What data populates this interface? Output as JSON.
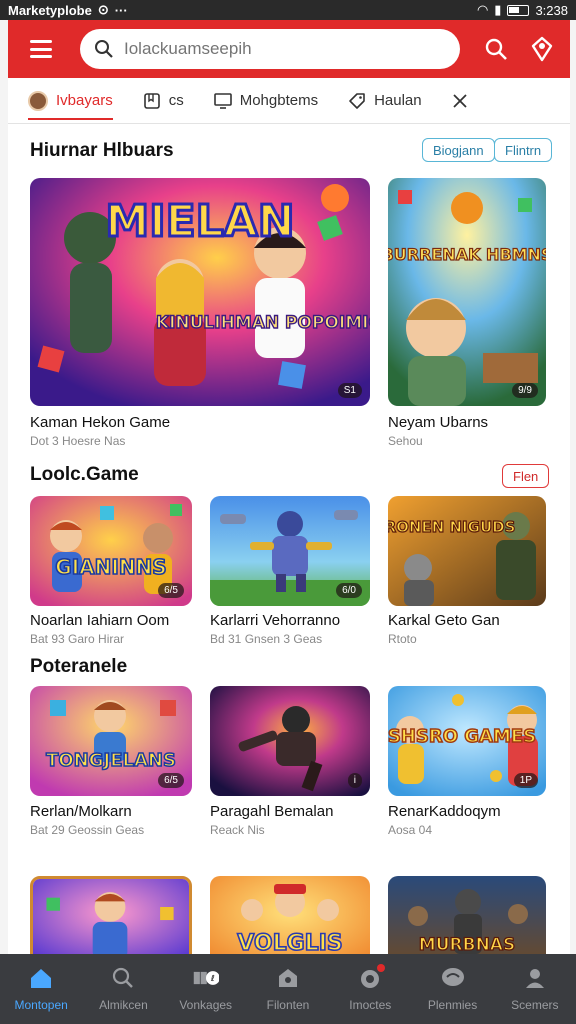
{
  "status_bar": {
    "app_name": "Marketyplobe",
    "time": "3:238"
  },
  "app_bar": {
    "search_placeholder": "Iolackuamseepih",
    "colors": {
      "brand": "#e02a2a"
    }
  },
  "filter_tabs": [
    {
      "label": "Ivbayars",
      "icon": "avatar-icon",
      "active": true
    },
    {
      "label": "cs",
      "icon": "bookmark-icon",
      "active": false
    },
    {
      "label": "Mohgbtems",
      "icon": "monitor-icon",
      "active": false
    },
    {
      "label": "Haulan",
      "icon": "tag-icon",
      "active": false
    }
  ],
  "sections": [
    {
      "title": "Hiurnar Hlbuars",
      "pills": [
        "Biogjann",
        "Flintrn"
      ],
      "cards": [
        {
          "title": "Kaman Hekon Game",
          "subtitle": "Dot 3  Hoesre Nas",
          "art_text": "MIELAN",
          "art_text2": "KINULIHMAN POPOIMICA",
          "badge": "S1"
        },
        {
          "title": "Neyam Ubarns",
          "subtitle": "Sehou",
          "art_text": "BURRENAK HBMNS",
          "badge": "9/9"
        }
      ]
    },
    {
      "title": "Loolc.Game",
      "pills": [
        "Flen"
      ],
      "cards": [
        {
          "title": "Noarlan Iahiarn Oom",
          "subtitle": "Bat 93  Garo Hirar",
          "art_text": "GIANINNS",
          "badge": "6/5"
        },
        {
          "title": "Karlarri Vehorranno",
          "subtitle": "Bd 31  Gnsen 3 Geas",
          "art_text": "",
          "badge": "6/0"
        },
        {
          "title": "Karkal Geto Gan",
          "subtitle": "Rtoto",
          "art_text": "RONEN NIGUDS",
          "badge": ""
        }
      ]
    },
    {
      "title": "Poteranele",
      "pills": [],
      "cards": [
        {
          "title": "Rerlan/Molkarn",
          "subtitle": "Bat 29  Geossin Geas",
          "art_text": "TONGJELANS",
          "badge": "6/5"
        },
        {
          "title": "Paragahl Bemalan",
          "subtitle": "Reack Nis",
          "art_text": "",
          "badge": "i"
        },
        {
          "title": "RenarKaddoqym",
          "subtitle": "Aosa 04",
          "art_text": "SHSRO GAMES",
          "badge": "1P"
        }
      ]
    },
    {
      "cards": [
        {
          "art_text": ""
        },
        {
          "art_text": "VOLGLIS"
        },
        {
          "art_text": "MURBNAS"
        }
      ]
    }
  ],
  "bottom_nav": [
    {
      "label": "Montopen",
      "icon": "home-icon",
      "active": true
    },
    {
      "label": "Almikcen",
      "icon": "search-icon",
      "active": false
    },
    {
      "label": "Vonkages",
      "icon": "library-icon",
      "active": false
    },
    {
      "label": "Filonten",
      "icon": "store-icon",
      "active": false
    },
    {
      "label": "Imoctes",
      "icon": "notifications-icon",
      "active": false,
      "dot": true
    },
    {
      "label": "Plenmies",
      "icon": "chat-icon",
      "active": false
    },
    {
      "label": "Scemers",
      "icon": "profile-icon",
      "active": false
    }
  ]
}
